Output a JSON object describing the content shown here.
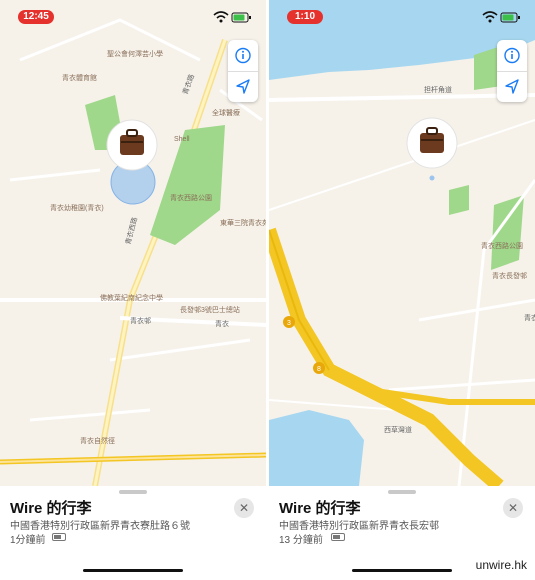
{
  "left_panel": {
    "status": {
      "time": "12:45"
    },
    "map": {
      "labels": {
        "school_primary": "聖公會何澤芸小學",
        "sports_centre": "青衣體育館",
        "kindergarten": "青衣幼稚園(青衣)",
        "secondary_school": "佛教葉紀南紀念中學",
        "pharmacy": "青衣藥房",
        "police": "全球醫療",
        "park": "青衣西路公園",
        "estate": "東華三院青衣苑",
        "shell": "Shell",
        "bus_terminus": "長發邨3號巴士總站",
        "estate_court": "青衣邨",
        "road_tsing_yi": "青衣路",
        "road_west": "青衣西路",
        "garden": "青衣自然徑",
        "district": "青衣"
      }
    },
    "sheet": {
      "title": "Wire 的行李",
      "address": "中國香港特別行政區新界青衣寮肚路６號",
      "time_ago": "1分鐘前",
      "battery_level": 0.7,
      "close_label": "✕"
    }
  },
  "right_panel": {
    "status": {
      "time": "1:10"
    },
    "map": {
      "labels": {
        "road_label_top": "担杆角道",
        "park": "青衣西路公園",
        "estate": "青衣長發邨",
        "road_east": "青衣西路",
        "route_marker_a": "3",
        "route_marker_b": "8",
        "road_bottom": "西草灣道"
      }
    },
    "sheet": {
      "title": "Wire 的行李",
      "address": "中國香港特別行政區新界青衣長宏邨",
      "time_ago": "13 分鐘前",
      "battery_level": 0.7,
      "close_label": "✕"
    }
  },
  "watermark": "unwire.hk",
  "colors": {
    "status_pill": "#e5322d",
    "park_green": "#9fd88a",
    "road_yellow": "#f3c623",
    "road_minor": "#ffffff",
    "water_blue": "#a7d7f0",
    "accuracy_circle": "#9cc4ee",
    "button_blue": "#1a7cf5"
  },
  "icons": {
    "info": "info-icon",
    "location": "location-arrow-icon",
    "close": "close-icon",
    "wifi": "wifi-icon",
    "battery": "battery-icon",
    "luggage": "luggage-icon"
  }
}
